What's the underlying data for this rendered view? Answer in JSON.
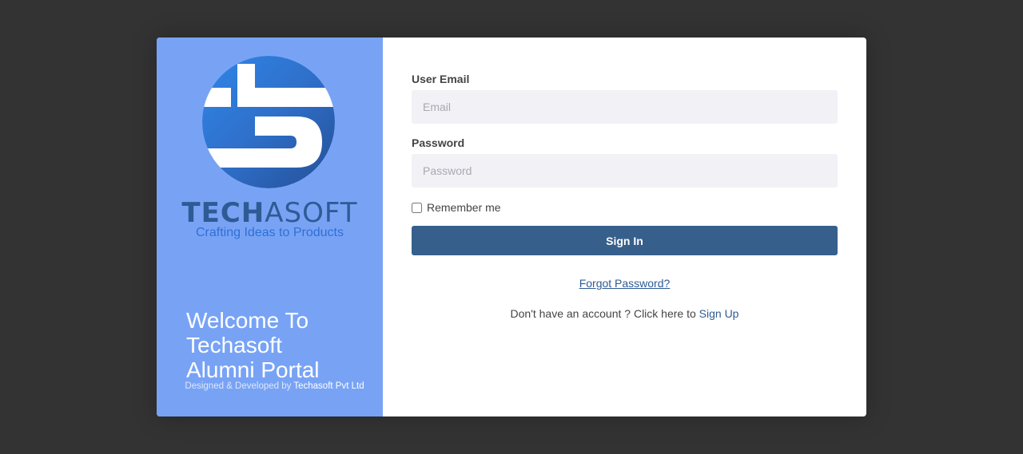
{
  "brand": {
    "name_bold": "TECH",
    "name_light": "ASOFT",
    "tagline": "Crafting Ideas to Products",
    "logo": "techasoft-logo-icon"
  },
  "welcome": {
    "line1": "Welcome To",
    "line2": "Techasoft",
    "line3": "Alumni Portal"
  },
  "credit": {
    "prefix": "Designed & Developed by ",
    "company": "Techasoft Pvt Ltd"
  },
  "form": {
    "email_label": "User Email",
    "email_placeholder": "Email",
    "email_value": "",
    "password_label": "Password",
    "password_placeholder": "Password",
    "password_value": "",
    "remember_label": "Remember me",
    "remember_checked": false,
    "signin_label": "Sign In",
    "forgot_label": "Forgot Password?",
    "signup_prefix": "Don't have an account ? Click here to ",
    "signup_link": "Sign Up"
  },
  "colors": {
    "background": "#333333",
    "panel": "#78a3f5",
    "accent": "#365f8c",
    "brand_blue": "#2e5b94"
  }
}
